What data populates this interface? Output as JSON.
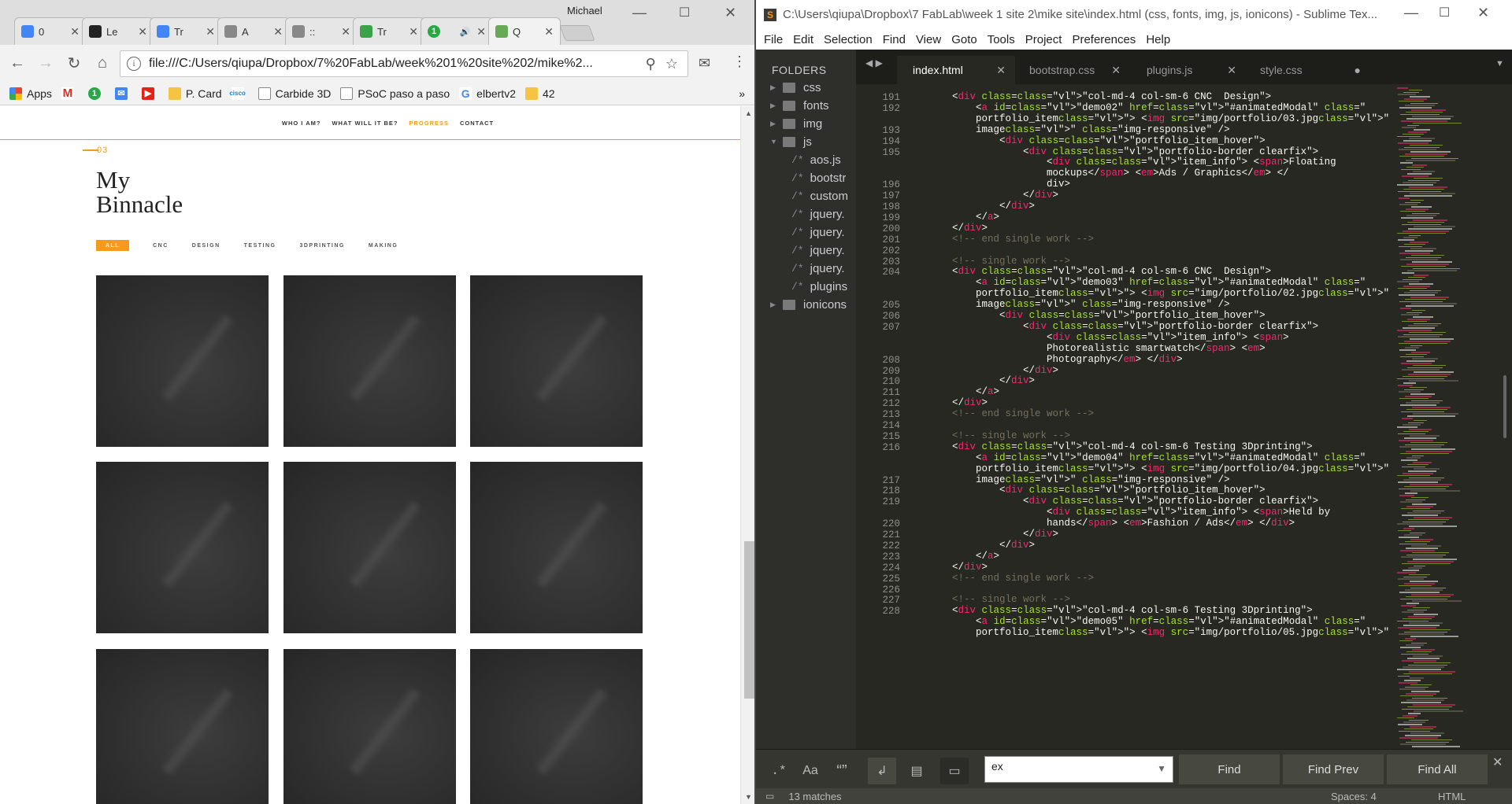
{
  "chrome": {
    "profile": "Michael",
    "tabs": [
      {
        "title": "0",
        "favicon": "docs-icon",
        "color": "#4285f4"
      },
      {
        "title": "Le",
        "favicon": "b-icon",
        "color": "#222"
      },
      {
        "title": "Tr",
        "favicon": "translate-icon",
        "color": "#4285f4"
      },
      {
        "title": "A",
        "favicon": "page-icon",
        "color": "#888"
      },
      {
        "title": "::",
        "favicon": "warning-icon",
        "color": "#888"
      },
      {
        "title": "Tr",
        "favicon": "tally-icon",
        "color": "#3aa34a"
      },
      {
        "title": "",
        "favicon": "green-circle-icon",
        "color": "#28a745",
        "badge": "1"
      },
      {
        "title": "Q",
        "favicon": "app-icon",
        "color": "#6a5"
      }
    ],
    "url": "file:///C:/Users/qiupa/Dropbox/7%20FabLab/week%201%20site%202/mike%2...",
    "bookmarks": [
      "Apps",
      "",
      "",
      "",
      "",
      "P. Card",
      "",
      "Carbide 3D",
      "PSoC paso a paso",
      "elbertv2",
      "42"
    ],
    "more": "»",
    "site": {
      "nav": [
        "WHO I AM?",
        "WHAT WILL IT BE?",
        "PROGRESS",
        "CONTACT"
      ],
      "active_nav": "PROGRESS",
      "section_number": "03",
      "title_line1": "My",
      "title_line2": "Binnacle",
      "filters": [
        "ALL",
        "CNC",
        "DESIGN",
        "TESTING",
        "3DPRINTING",
        "MAKING"
      ],
      "accent": "#f29b1f"
    }
  },
  "sublime": {
    "title": "C:\\Users\\qiupa\\Dropbox\\7 FabLab\\week 1 site 2\\mike site\\index.html (css, fonts, img, js, ionicons) - Sublime Tex...",
    "menu": [
      "File",
      "Edit",
      "Selection",
      "Find",
      "View",
      "Goto",
      "Tools",
      "Project",
      "Preferences",
      "Help"
    ],
    "sidebar_header": "FOLDERS",
    "folders": [
      {
        "name": "css",
        "type": "folder"
      },
      {
        "name": "fonts",
        "type": "folder"
      },
      {
        "name": "img",
        "type": "folder"
      },
      {
        "name": "js",
        "type": "folder-open"
      },
      {
        "name": "aos.js",
        "type": "file"
      },
      {
        "name": "bootstr",
        "type": "file"
      },
      {
        "name": "custom",
        "type": "file"
      },
      {
        "name": "jquery.",
        "type": "file"
      },
      {
        "name": "jquery.",
        "type": "file"
      },
      {
        "name": "jquery.",
        "type": "file"
      },
      {
        "name": "jquery.",
        "type": "file"
      },
      {
        "name": "plugins",
        "type": "file"
      },
      {
        "name": "ionicons",
        "type": "folder"
      }
    ],
    "tabs": [
      "index.html",
      "bootstrap.css",
      "plugins.js",
      "style.css"
    ],
    "active_tab": "index.html",
    "find_text": "ex",
    "find_buttons": [
      "Find",
      "Find Prev",
      "Find All"
    ],
    "status_left": "13 matches",
    "status_spaces": "Spaces: 4",
    "status_syntax": "HTML",
    "line_numbers": [
      "191",
      "192",
      "",
      "193",
      "194",
      "195",
      "",
      "",
      "196",
      "197",
      "198",
      "199",
      "200",
      "201",
      "202",
      "203",
      "204",
      "",
      "",
      "205",
      "206",
      "207",
      "",
      "",
      "208",
      "209",
      "210",
      "211",
      "212",
      "213",
      "214",
      "215",
      "216",
      "",
      "",
      "217",
      "218",
      "219",
      "",
      "220",
      "221",
      "222",
      "223",
      "224",
      "225",
      "226",
      "227",
      "228",
      ""
    ],
    "code_lines": [
      "        <div class=\"col-md-4 col-sm-6 CNC  Design\">",
      "            <a id=\"demo02\" href=\"#animatedModal\" class=\"",
      "            portfolio_item\"> <img src=\"img/portfolio/03.jpg\" alt=\"",
      "            image\" class=\"img-responsive\" />",
      "                <div class=\"portfolio_item_hover\">",
      "                    <div class=\"portfolio-border clearfix\">",
      "                        <div class=\"item_info\"> <span>Floating",
      "                        mockups</span> <em>Ads / Graphics</em> </",
      "                        div>",
      "                    </div>",
      "                </div>",
      "            </a>",
      "        </div>",
      "        <!-- end single work -->",
      "",
      "        <!-- single work -->",
      "        <div class=\"col-md-4 col-sm-6 CNC  Design\">",
      "            <a id=\"demo03\" href=\"#animatedModal\" class=\"",
      "            portfolio_item\"> <img src=\"img/portfolio/02.jpg\" alt=\"",
      "            image\" class=\"img-responsive\" />",
      "                <div class=\"portfolio_item_hover\">",
      "                    <div class=\"portfolio-border clearfix\">",
      "                        <div class=\"item_info\"> <span>",
      "                        Photorealistic smartwatch</span> <em>",
      "                        Photography</em> </div>",
      "                    </div>",
      "                </div>",
      "            </a>",
      "        </div>",
      "        <!-- end single work -->",
      "",
      "        <!-- single work -->",
      "        <div class=\"col-md-4 col-sm-6 Testing 3Dprinting\">",
      "            <a id=\"demo04\" href=\"#animatedModal\" class=\"",
      "            portfolio_item\"> <img src=\"img/portfolio/04.jpg\" alt=\"",
      "            image\" class=\"img-responsive\" />",
      "                <div class=\"portfolio_item_hover\">",
      "                    <div class=\"portfolio-border clearfix\">",
      "                        <div class=\"item_info\"> <span>Held by",
      "                        hands</span> <em>Fashion / Ads</em> </div>",
      "                    </div>",
      "                </div>",
      "            </a>",
      "        </div>",
      "        <!-- end single work -->",
      "",
      "        <!-- single work -->",
      "        <div class=\"col-md-4 col-sm-6 Testing 3Dprinting\">",
      "            <a id=\"demo05\" href=\"#animatedModal\" class=\"",
      "            portfolio_item\"> <img src=\"img/portfolio/05.jpg\" alt=\""
    ]
  }
}
